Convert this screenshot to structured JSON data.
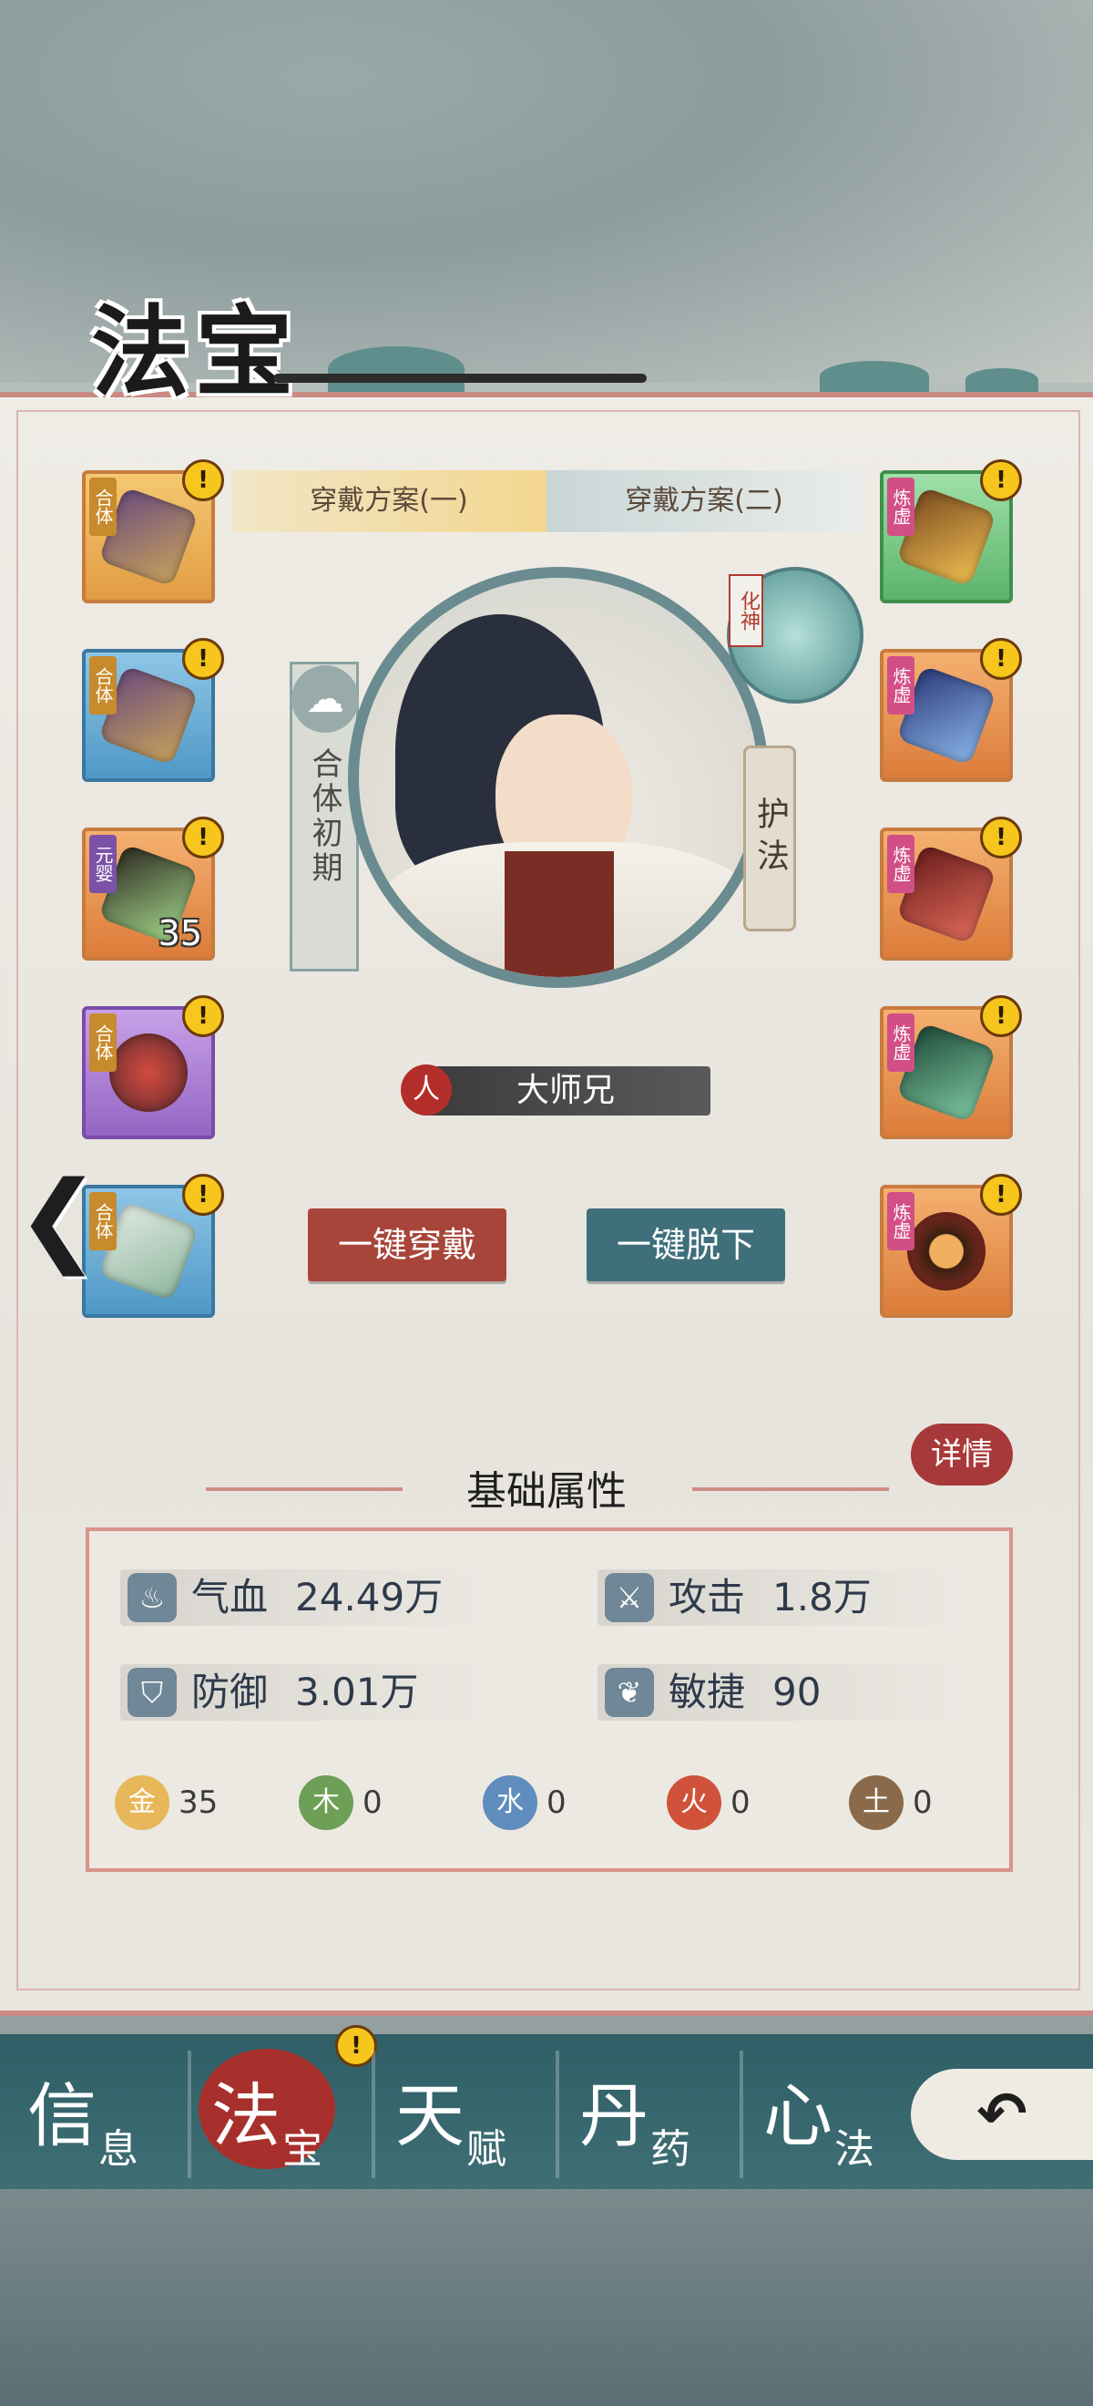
{
  "title": "法宝",
  "plan_tabs": [
    "穿戴方案(一)",
    "穿戴方案(二)"
  ],
  "left_slots": [
    {
      "tag": "合体",
      "alert": "!",
      "count": ""
    },
    {
      "tag": "合体",
      "alert": "!",
      "count": ""
    },
    {
      "tag": "元婴",
      "alert": "!",
      "count": "35"
    },
    {
      "tag": "合体",
      "alert": "!",
      "count": ""
    },
    {
      "tag": "合体",
      "alert": "!",
      "count": ""
    }
  ],
  "right_slots": [
    {
      "tag": "炼虚",
      "alert": "!"
    },
    {
      "tag": "炼虚",
      "alert": "!"
    },
    {
      "tag": "炼虚",
      "alert": "!"
    },
    {
      "tag": "炼虚",
      "alert": "!"
    },
    {
      "tag": "炼虚",
      "alert": "!"
    }
  ],
  "character": {
    "realm": "合体初期",
    "protect_label": "护法",
    "transform_tag": "化神",
    "race_badge": "人",
    "name": "大师兄"
  },
  "buttons": {
    "equip_all": "一键穿戴",
    "unequip_all": "一键脱下"
  },
  "back_arrow": "❮",
  "stats": {
    "detail_label": "详情",
    "title": "基础属性",
    "items": [
      {
        "icon": "blood-icon",
        "label": "气血",
        "value": "24.49万"
      },
      {
        "icon": "attack-icon",
        "label": "攻击",
        "value": "1.8万"
      },
      {
        "icon": "shield-icon",
        "label": "防御",
        "value": "3.01万"
      },
      {
        "icon": "agility-icon",
        "label": "敏捷",
        "value": "90"
      }
    ],
    "elements": [
      {
        "glyph": "金",
        "value": "35",
        "color": "#e7b85a"
      },
      {
        "glyph": "木",
        "value": "0",
        "color": "#6e9f57"
      },
      {
        "glyph": "水",
        "value": "0",
        "color": "#5f8dbd"
      },
      {
        "glyph": "火",
        "value": "0",
        "color": "#d0523a"
      },
      {
        "glyph": "土",
        "value": "0",
        "color": "#8a6a4a"
      }
    ]
  },
  "nav": [
    {
      "big": "信",
      "small": "息"
    },
    {
      "big": "法",
      "small": "宝"
    },
    {
      "big": "天",
      "small": "赋"
    },
    {
      "big": "丹",
      "small": "药"
    },
    {
      "big": "心",
      "small": "法"
    }
  ],
  "nav_alert": "!",
  "return_icon": "↶",
  "colors": {
    "accent_red": "#a8302c",
    "teal": "#3f6f75",
    "gold": "#f6c61c"
  }
}
